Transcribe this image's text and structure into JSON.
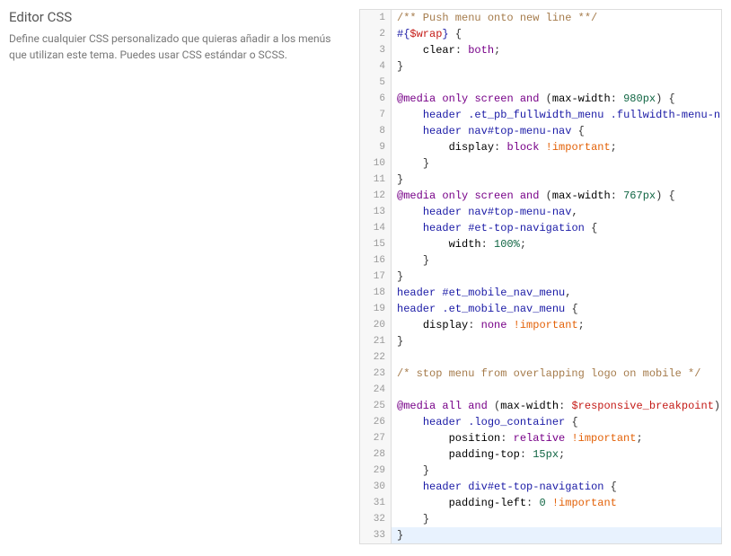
{
  "sidebar": {
    "title": "Editor CSS",
    "description": "Define cualquier CSS personalizado que quieras añadir a los menús que utilizan este tema. Puedes usar CSS estándar o SCSS."
  },
  "editor": {
    "highlighted_line": 33,
    "lines": [
      [
        [
          "comment",
          "/** Push menu onto new line **/"
        ]
      ],
      [
        [
          "selector",
          "#{"
        ],
        [
          "var",
          "$wrap"
        ],
        [
          "selector",
          "}"
        ],
        [
          "default",
          " "
        ],
        [
          "punct",
          "{"
        ]
      ],
      [
        [
          "default",
          "    "
        ],
        [
          "prop",
          "clear"
        ],
        [
          "punct",
          ":"
        ],
        [
          "default",
          " "
        ],
        [
          "kw",
          "both"
        ],
        [
          "punct",
          ";"
        ]
      ],
      [
        [
          "punct",
          "}"
        ]
      ],
      [],
      [
        [
          "atrule",
          "@media"
        ],
        [
          "default",
          " "
        ],
        [
          "kw",
          "only"
        ],
        [
          "default",
          " "
        ],
        [
          "kw",
          "screen"
        ],
        [
          "default",
          " "
        ],
        [
          "kw",
          "and"
        ],
        [
          "default",
          " "
        ],
        [
          "punct",
          "("
        ],
        [
          "prop",
          "max-width"
        ],
        [
          "punct",
          ":"
        ],
        [
          "default",
          " "
        ],
        [
          "number",
          "980px"
        ],
        [
          "punct",
          ")"
        ],
        [
          "default",
          " "
        ],
        [
          "punct",
          "{"
        ]
      ],
      [
        [
          "default",
          "    "
        ],
        [
          "tag",
          "header"
        ],
        [
          "default",
          " "
        ],
        [
          "selector",
          ".et_pb_fullwidth_menu"
        ],
        [
          "default",
          " "
        ],
        [
          "selector",
          ".fullwidth-menu-nav"
        ],
        [
          "punct",
          ","
        ]
      ],
      [
        [
          "default",
          "    "
        ],
        [
          "tag",
          "header"
        ],
        [
          "default",
          " "
        ],
        [
          "tag",
          "nav"
        ],
        [
          "selector",
          "#top-menu-nav"
        ],
        [
          "default",
          " "
        ],
        [
          "punct",
          "{"
        ]
      ],
      [
        [
          "default",
          "        "
        ],
        [
          "prop",
          "display"
        ],
        [
          "punct",
          ":"
        ],
        [
          "default",
          " "
        ],
        [
          "kw",
          "block"
        ],
        [
          "default",
          " "
        ],
        [
          "important",
          "!important"
        ],
        [
          "punct",
          ";"
        ]
      ],
      [
        [
          "default",
          "    "
        ],
        [
          "punct",
          "}"
        ]
      ],
      [
        [
          "punct",
          "}"
        ]
      ],
      [
        [
          "atrule",
          "@media"
        ],
        [
          "default",
          " "
        ],
        [
          "kw",
          "only"
        ],
        [
          "default",
          " "
        ],
        [
          "kw",
          "screen"
        ],
        [
          "default",
          " "
        ],
        [
          "kw",
          "and"
        ],
        [
          "default",
          " "
        ],
        [
          "punct",
          "("
        ],
        [
          "prop",
          "max-width"
        ],
        [
          "punct",
          ":"
        ],
        [
          "default",
          " "
        ],
        [
          "number",
          "767px"
        ],
        [
          "punct",
          ")"
        ],
        [
          "default",
          " "
        ],
        [
          "punct",
          "{"
        ]
      ],
      [
        [
          "default",
          "    "
        ],
        [
          "tag",
          "header"
        ],
        [
          "default",
          " "
        ],
        [
          "tag",
          "nav"
        ],
        [
          "selector",
          "#top-menu-nav"
        ],
        [
          "punct",
          ","
        ]
      ],
      [
        [
          "default",
          "    "
        ],
        [
          "tag",
          "header"
        ],
        [
          "default",
          " "
        ],
        [
          "selector",
          "#et-top-navigation"
        ],
        [
          "default",
          " "
        ],
        [
          "punct",
          "{"
        ]
      ],
      [
        [
          "default",
          "        "
        ],
        [
          "prop",
          "width"
        ],
        [
          "punct",
          ":"
        ],
        [
          "default",
          " "
        ],
        [
          "number",
          "100%"
        ],
        [
          "punct",
          ";"
        ]
      ],
      [
        [
          "default",
          "    "
        ],
        [
          "punct",
          "}"
        ]
      ],
      [
        [
          "punct",
          "}"
        ]
      ],
      [
        [
          "tag",
          "header"
        ],
        [
          "default",
          " "
        ],
        [
          "selector",
          "#et_mobile_nav_menu"
        ],
        [
          "punct",
          ","
        ]
      ],
      [
        [
          "tag",
          "header"
        ],
        [
          "default",
          " "
        ],
        [
          "selector",
          ".et_mobile_nav_menu"
        ],
        [
          "default",
          " "
        ],
        [
          "punct",
          "{"
        ]
      ],
      [
        [
          "default",
          "    "
        ],
        [
          "prop",
          "display"
        ],
        [
          "punct",
          ":"
        ],
        [
          "default",
          " "
        ],
        [
          "kw",
          "none"
        ],
        [
          "default",
          " "
        ],
        [
          "important",
          "!important"
        ],
        [
          "punct",
          ";"
        ]
      ],
      [
        [
          "punct",
          "}"
        ]
      ],
      [],
      [
        [
          "comment",
          "/* stop menu from overlapping logo on mobile */"
        ]
      ],
      [],
      [
        [
          "atrule",
          "@media"
        ],
        [
          "default",
          " "
        ],
        [
          "kw",
          "all"
        ],
        [
          "default",
          " "
        ],
        [
          "kw",
          "and"
        ],
        [
          "default",
          " "
        ],
        [
          "punct",
          "("
        ],
        [
          "prop",
          "max-width"
        ],
        [
          "punct",
          ":"
        ],
        [
          "default",
          " "
        ],
        [
          "var",
          "$responsive_breakpoint"
        ],
        [
          "punct",
          ")"
        ],
        [
          "default",
          " "
        ],
        [
          "punct",
          "{"
        ]
      ],
      [
        [
          "default",
          "    "
        ],
        [
          "tag",
          "header"
        ],
        [
          "default",
          " "
        ],
        [
          "selector",
          ".logo_container"
        ],
        [
          "default",
          " "
        ],
        [
          "punct",
          "{"
        ]
      ],
      [
        [
          "default",
          "        "
        ],
        [
          "prop",
          "position"
        ],
        [
          "punct",
          ":"
        ],
        [
          "default",
          " "
        ],
        [
          "kw",
          "relative"
        ],
        [
          "default",
          " "
        ],
        [
          "important",
          "!important"
        ],
        [
          "punct",
          ";"
        ]
      ],
      [
        [
          "default",
          "        "
        ],
        [
          "prop",
          "padding-top"
        ],
        [
          "punct",
          ":"
        ],
        [
          "default",
          " "
        ],
        [
          "number",
          "15px"
        ],
        [
          "punct",
          ";"
        ]
      ],
      [
        [
          "default",
          "    "
        ],
        [
          "punct",
          "}"
        ]
      ],
      [
        [
          "default",
          "    "
        ],
        [
          "tag",
          "header"
        ],
        [
          "default",
          " "
        ],
        [
          "tag",
          "div"
        ],
        [
          "selector",
          "#et-top-navigation"
        ],
        [
          "default",
          " "
        ],
        [
          "punct",
          "{"
        ]
      ],
      [
        [
          "default",
          "        "
        ],
        [
          "prop",
          "padding-left"
        ],
        [
          "punct",
          ":"
        ],
        [
          "default",
          " "
        ],
        [
          "number",
          "0"
        ],
        [
          "default",
          " "
        ],
        [
          "important",
          "!important"
        ]
      ],
      [
        [
          "default",
          "    "
        ],
        [
          "punct",
          "}"
        ]
      ],
      [
        [
          "punct",
          "}"
        ]
      ]
    ]
  }
}
